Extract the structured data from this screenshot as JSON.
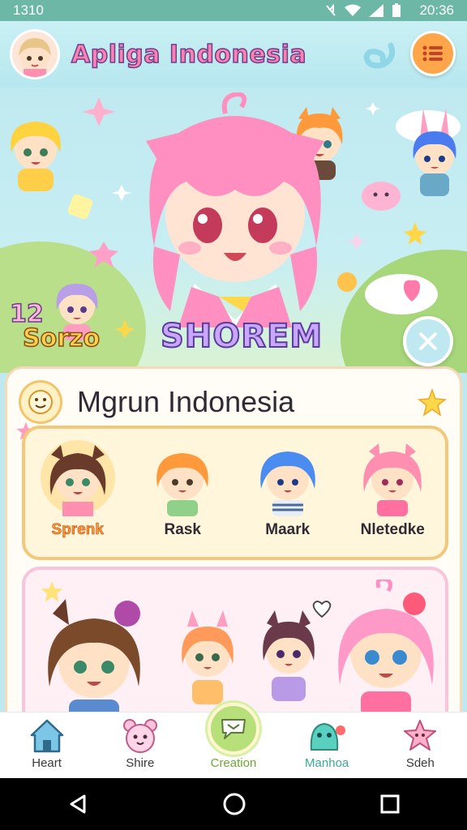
{
  "status_bar": {
    "time_left": "1310",
    "time_right": "20:36"
  },
  "header": {
    "title": "Apliga Indonesia",
    "menu_icon": "list-icon",
    "swirl_icon": "swirl-icon"
  },
  "hero": {
    "label": "SHOREM",
    "badge_number": "12",
    "badge_word": "Sorzo",
    "close_icon": "close-icon"
  },
  "section": {
    "title": "Mgrun Indonesia"
  },
  "characters": [
    {
      "name": "Sprenk",
      "selected": true
    },
    {
      "name": "Rask",
      "selected": false
    },
    {
      "name": "Maark",
      "selected": false
    },
    {
      "name": "Nletedke",
      "selected": false
    }
  ],
  "bottom_nav": [
    {
      "label": "Heart",
      "icon": "house-icon"
    },
    {
      "label": "Shire",
      "icon": "bear-face-icon"
    },
    {
      "label": "Creation",
      "icon": "chat-bubble-icon",
      "active": true
    },
    {
      "label": "Manhoa",
      "icon": "ghost-icon"
    },
    {
      "label": "Sdeh",
      "icon": "starfish-icon"
    }
  ],
  "colors": {
    "status_bar": "#6cb7a6",
    "accent_orange": "#ffa54a",
    "accent_green": "#b8e07a",
    "panel_border": "#f3c87a",
    "title_pink": "#ff7fae"
  }
}
